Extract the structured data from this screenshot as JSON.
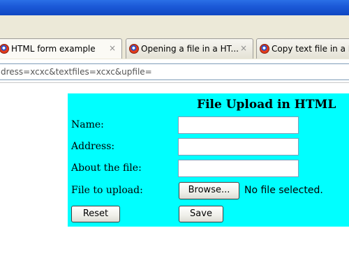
{
  "browser": {
    "tabs": [
      {
        "label": "HTML form example",
        "close": "×"
      },
      {
        "label": "Opening a file in a HT...",
        "close": "×"
      },
      {
        "label": "Copy text file in a H"
      }
    ],
    "address": "dress=xcxc&textfiles=xcxc&upfile="
  },
  "form": {
    "title": "File Upload in HTML",
    "fields": {
      "name_label": "Name:",
      "address_label": "Address:",
      "about_label": "About the file:",
      "file_label": "File to upload:"
    },
    "browse_label": "Browse...",
    "file_status": "No file selected.",
    "reset_label": "Reset",
    "save_label": "Save",
    "colors": {
      "form_background": "#00ffff"
    }
  }
}
